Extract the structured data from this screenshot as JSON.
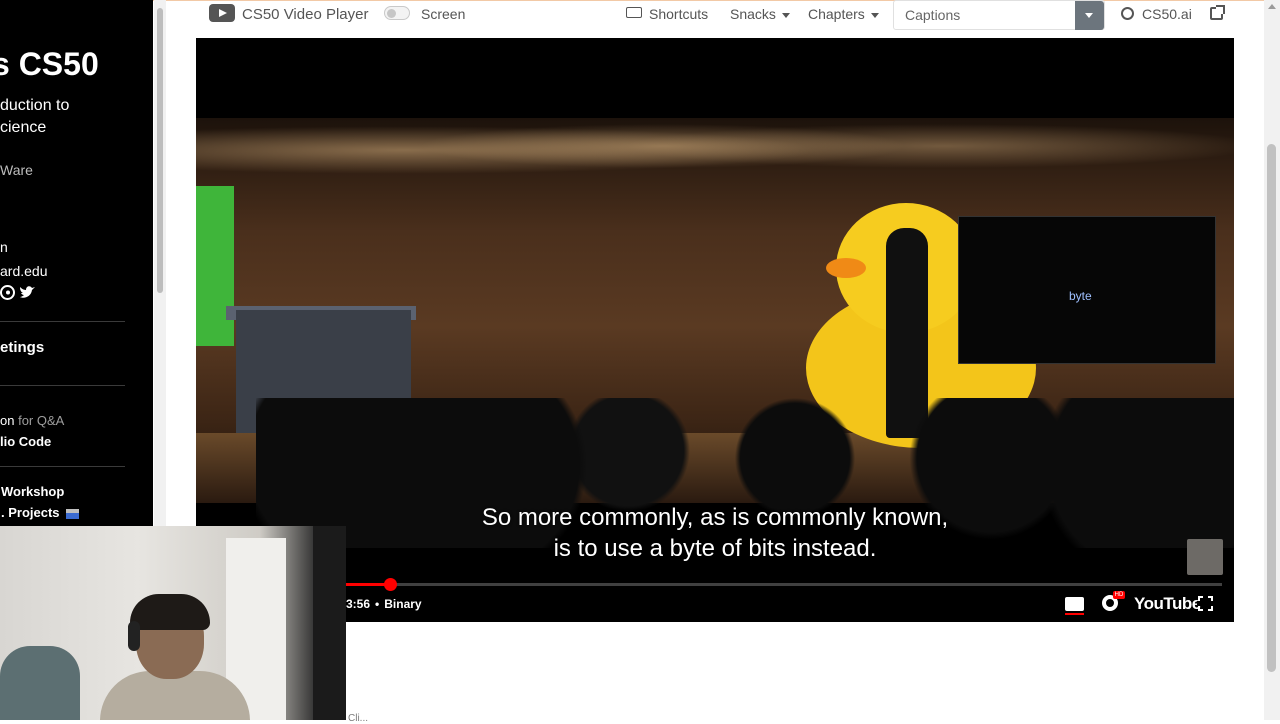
{
  "sidebar": {
    "title": "s CS50",
    "subtitle": "duction to\ncience",
    "author": "Ware",
    "line1": "n",
    "email": "ard.edu",
    "meetings": "etings",
    "qa_link": "on",
    "qa_suffix": "for Q&A",
    "vscode": "lio Code",
    "workshop": "Workshop",
    "projects": ". Projects"
  },
  "toolbar": {
    "title": "CS50 Video Player",
    "screen_label": "Screen",
    "shortcuts": "Shortcuts",
    "snacks": "Snacks",
    "chapters": "Chapters",
    "captions_value": "Captions",
    "ai_label": "CS50.ai"
  },
  "video": {
    "slide_word": "byte",
    "subtitle_line1": "So more commonly, as is commonly known,",
    "subtitle_line2": "is to use a byte of bits instead.",
    "time": "3:56",
    "chapter": "Binary",
    "progress": 0.05,
    "hd_badge": "HD",
    "youtube_wordmark": "YouTube"
  },
  "footer": {
    "clipped_text": "Cli..."
  },
  "colors": {
    "progress": "#ff0000",
    "sidebar_bg": "#000000",
    "captions_button": "#6c757d"
  }
}
